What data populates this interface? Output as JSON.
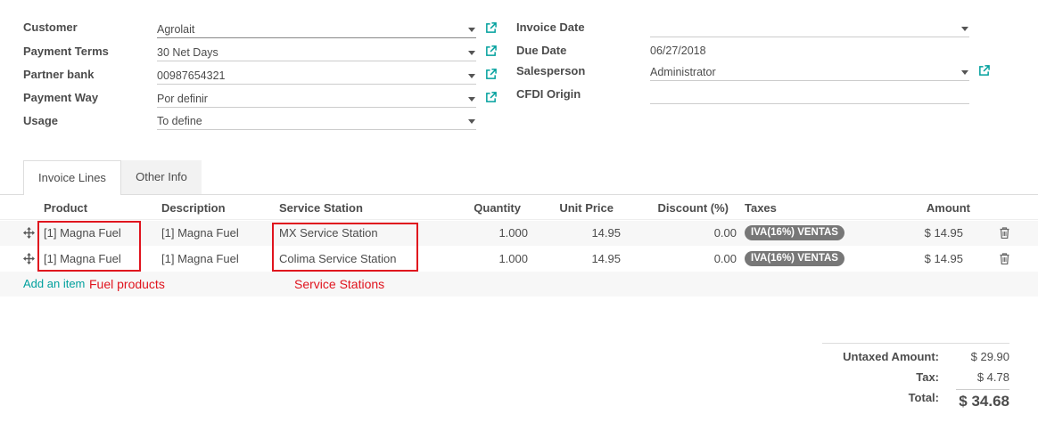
{
  "form": {
    "left": [
      {
        "label": "Customer",
        "value": "Agrolait"
      },
      {
        "label": "Payment Terms",
        "value": "30 Net Days"
      },
      {
        "label": "Partner bank",
        "value": "00987654321"
      },
      {
        "label": "Payment Way",
        "value": "Por definir"
      },
      {
        "label": "Usage",
        "value": "To define"
      }
    ],
    "right": [
      {
        "label": "Invoice Date",
        "value": ""
      },
      {
        "label": "Due Date",
        "value": "06/27/2018"
      },
      {
        "label": "Salesperson",
        "value": "Administrator"
      },
      {
        "label": "CFDI Origin",
        "value": ""
      }
    ]
  },
  "tabs": [
    {
      "label": "Invoice Lines",
      "active": true
    },
    {
      "label": "Other Info",
      "active": false
    }
  ],
  "table": {
    "columns": [
      "Product",
      "Description",
      "Service Station",
      "Quantity",
      "Unit Price",
      "Discount (%)",
      "Taxes",
      "Amount"
    ],
    "rows": [
      {
        "product": "[1] Magna Fuel",
        "description": "[1] Magna Fuel",
        "station": "MX Service Station",
        "quantity": "1.000",
        "unit_price": "14.95",
        "discount": "0.00",
        "tax": "IVA(16%) VENTAS",
        "amount": "$ 14.95"
      },
      {
        "product": "[1] Magna Fuel",
        "description": "[1] Magna Fuel",
        "station": "Colima Service Station",
        "quantity": "1.000",
        "unit_price": "14.95",
        "discount": "0.00",
        "tax": "IVA(16%) VENTAS",
        "amount": "$ 14.95"
      }
    ],
    "add_item": "Add an item"
  },
  "annotations": {
    "fuel": "Fuel products",
    "stations": "Service Stations"
  },
  "totals": {
    "untaxed_label": "Untaxed Amount:",
    "untaxed_value": "$ 29.90",
    "tax_label": "Tax:",
    "tax_value": "$ 4.78",
    "total_label": "Total:",
    "total_value": "$ 34.68"
  },
  "colors": {
    "accent": "#00a09d",
    "annotation": "#e0141e",
    "badge": "#777777"
  }
}
